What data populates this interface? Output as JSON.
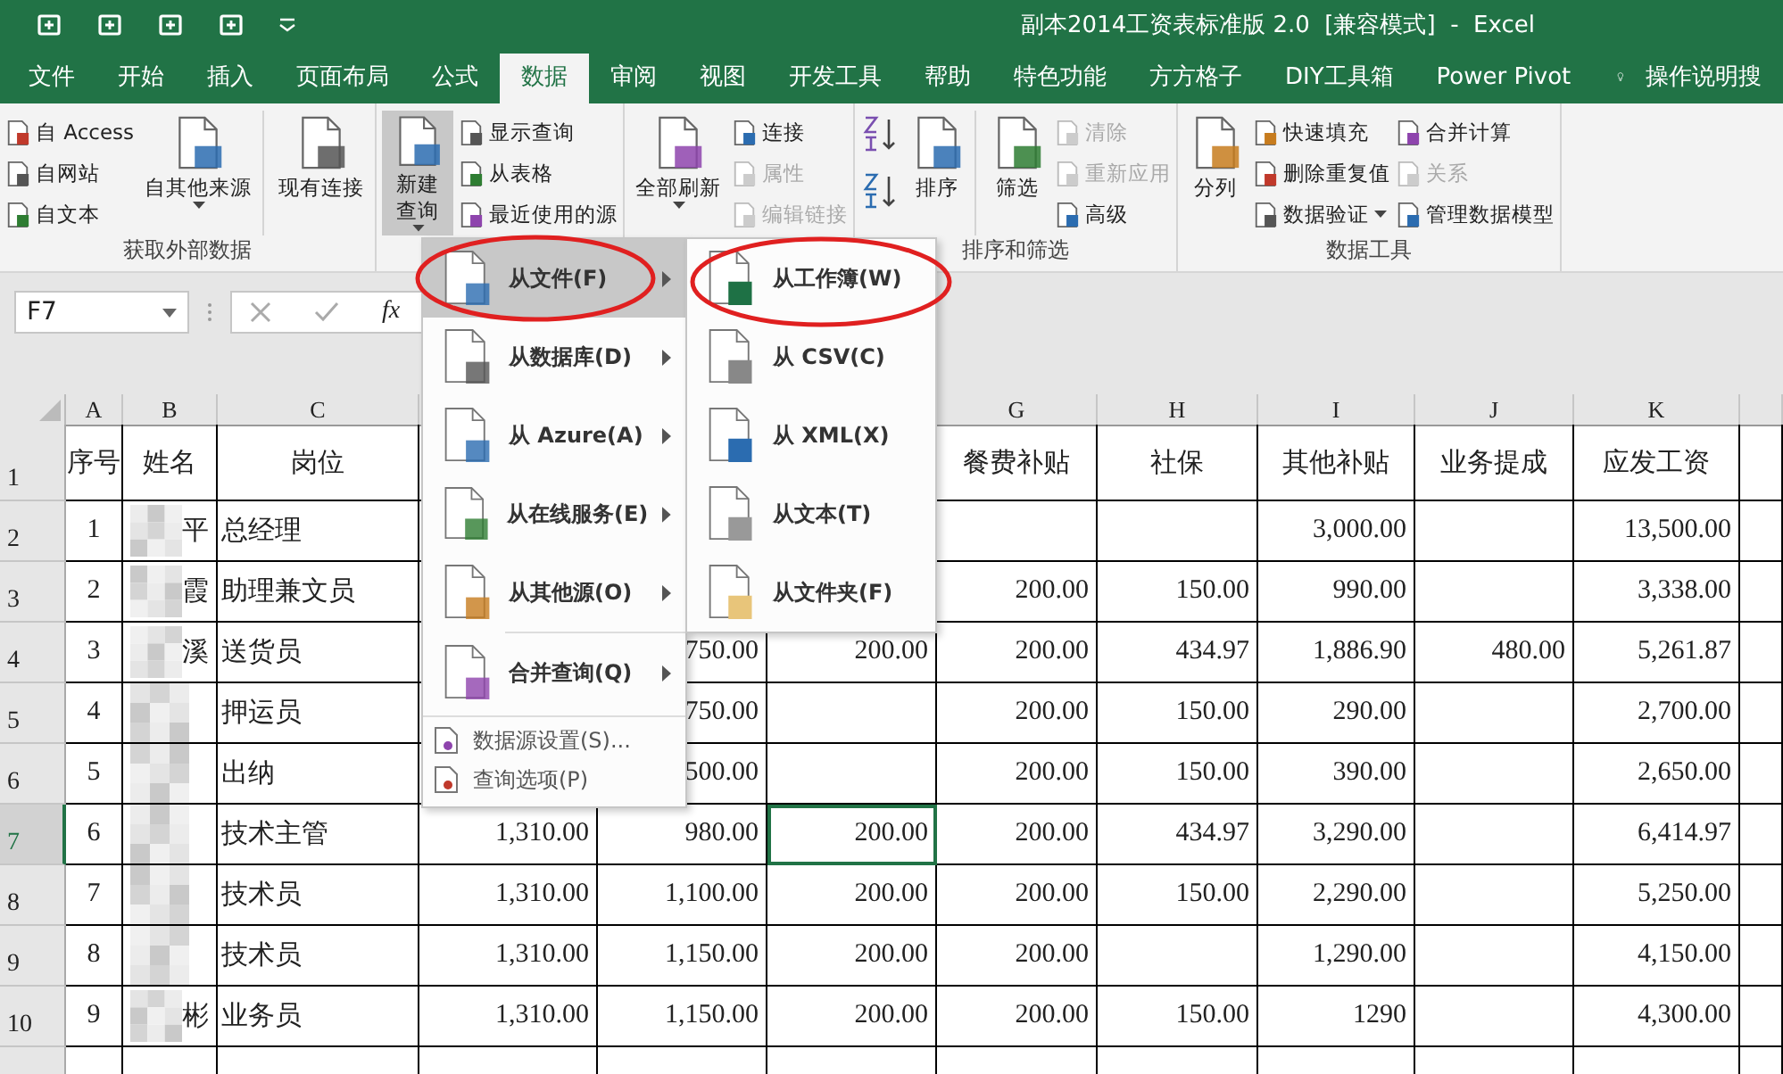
{
  "window": {
    "title": "副本2014工资表标准版 2.0  [兼容模式]  -  Excel"
  },
  "tabs": [
    {
      "label": "文件",
      "selected": false
    },
    {
      "label": "开始",
      "selected": false
    },
    {
      "label": "插入",
      "selected": false
    },
    {
      "label": "页面布局",
      "selected": false
    },
    {
      "label": "公式",
      "selected": false
    },
    {
      "label": "数据",
      "selected": true
    },
    {
      "label": "审阅",
      "selected": false
    },
    {
      "label": "视图",
      "selected": false
    },
    {
      "label": "开发工具",
      "selected": false
    },
    {
      "label": "帮助",
      "selected": false
    },
    {
      "label": "特色功能",
      "selected": false
    },
    {
      "label": "方方格子",
      "selected": false
    },
    {
      "label": "DIY工具箱",
      "selected": false
    },
    {
      "label": "Power Pivot",
      "selected": false
    }
  ],
  "tell_me": "操作说明搜",
  "ribbon": {
    "groups": [
      {
        "label": "获取外部数据",
        "columns": [
          {
            "kind": "stack",
            "items": [
              {
                "label": "自 Access",
                "disabled": false
              },
              {
                "label": "自网站",
                "disabled": false
              },
              {
                "label": "自文本",
                "disabled": false
              }
            ]
          },
          {
            "kind": "large",
            "label": "自其他来源",
            "dropdown": true,
            "pressed": false
          },
          {
            "kind": "large",
            "label": "现有连接",
            "dropdown": false,
            "pressed": false,
            "separator_before": true
          }
        ]
      },
      {
        "columns": [
          {
            "kind": "large",
            "label": "新建查询",
            "dropdown": true,
            "pressed": true
          },
          {
            "kind": "stack",
            "items": [
              {
                "label": "显示查询",
                "disabled": false
              },
              {
                "label": "从表格",
                "disabled": false
              },
              {
                "label": "最近使用的源",
                "disabled": false
              }
            ]
          }
        ]
      },
      {
        "columns": [
          {
            "kind": "large",
            "label": "全部刷新",
            "dropdown": true,
            "pressed": false
          },
          {
            "kind": "stack",
            "items": [
              {
                "label": "连接",
                "disabled": false
              },
              {
                "label": "属性",
                "disabled": true
              },
              {
                "label": "编辑链接",
                "disabled": true
              }
            ]
          }
        ]
      },
      {
        "label": "排序和筛选",
        "columns": [
          {
            "kind": "sort"
          },
          {
            "kind": "large",
            "label": "排序",
            "dropdown": false,
            "pressed": false
          },
          {
            "kind": "large",
            "label": "筛选",
            "dropdown": false,
            "pressed": false,
            "separator_before": true
          },
          {
            "kind": "stack",
            "items": [
              {
                "label": "清除",
                "disabled": true
              },
              {
                "label": "重新应用",
                "disabled": true
              },
              {
                "label": "高级",
                "disabled": false
              }
            ]
          }
        ]
      },
      {
        "label": "数据工具",
        "columns": [
          {
            "kind": "large",
            "label": "分列",
            "dropdown": false,
            "pressed": false
          },
          {
            "kind": "stack",
            "items": [
              {
                "label": "快速填充",
                "disabled": false
              },
              {
                "label": "删除重复值",
                "disabled": false
              },
              {
                "label": "数据验证",
                "disabled": false,
                "dropdown": true
              }
            ]
          },
          {
            "kind": "stack",
            "items": [
              {
                "label": "合并计算",
                "disabled": false
              },
              {
                "label": "关系",
                "disabled": true
              },
              {
                "label": "管理数据模型",
                "disabled": false
              }
            ]
          }
        ]
      }
    ]
  },
  "formula_bar": {
    "name_box": "F7",
    "fx": "fx"
  },
  "menu": {
    "items": [
      {
        "kind": "large",
        "label": "从文件(F)",
        "submenu": true,
        "selected": true
      },
      {
        "kind": "large",
        "label": "从数据库(D)",
        "submenu": true,
        "selected": false
      },
      {
        "kind": "large",
        "label": "从 Azure(A)",
        "submenu": true,
        "selected": false
      },
      {
        "kind": "large",
        "label": "从在线服务(E)",
        "submenu": true,
        "selected": false
      },
      {
        "kind": "large",
        "label": "从其他源(O)",
        "submenu": true,
        "selected": false
      },
      {
        "kind": "large",
        "label": "合并查询(Q)",
        "submenu": true,
        "selected": false,
        "separator_before": true
      },
      {
        "kind": "small",
        "label": "数据源设置(S)...",
        "selected": false,
        "separator_before": true
      },
      {
        "kind": "small",
        "label": "查询选项(P)",
        "selected": false
      }
    ],
    "submenu": {
      "items": [
        {
          "label": "从工作簿(W)"
        },
        {
          "label": "从 CSV(C)"
        },
        {
          "label": "从 XML(X)"
        },
        {
          "label": "从文本(T)"
        },
        {
          "label": "从文件夹(F)"
        }
      ]
    }
  },
  "sheet": {
    "columns": [
      {
        "letter": "A",
        "active": false
      },
      {
        "letter": "B",
        "active": false
      },
      {
        "letter": "C",
        "active": false
      },
      {
        "active": false
      },
      {
        "active": false
      },
      {
        "active": true
      },
      {
        "letter": "G",
        "active": false
      },
      {
        "letter": "H",
        "active": false
      },
      {
        "letter": "I",
        "active": false
      },
      {
        "letter": "J",
        "active": false
      },
      {
        "letter": "K",
        "active": false
      }
    ],
    "rows": [
      {
        "kind": "header",
        "num": "1",
        "selected": false,
        "cells": [
          "序号",
          "姓名",
          "岗位",
          null,
          null,
          null,
          "餐费补贴",
          "社保",
          "其他补贴",
          "业务提成",
          "应发工资"
        ]
      },
      {
        "kind": "data",
        "num": "2",
        "selected": false,
        "cells": [
          "1",
          "平",
          "总经理",
          null,
          null,
          null,
          null,
          null,
          "3,000.00",
          null,
          "13,500.00"
        ]
      },
      {
        "kind": "data",
        "num": "3",
        "selected": false,
        "cells": [
          "2",
          "霞",
          "助理兼文员",
          null,
          null,
          null,
          "200.00",
          "150.00",
          "990.00",
          null,
          "3,338.00"
        ]
      },
      {
        "kind": "data",
        "num": "4",
        "selected": false,
        "cells": [
          "3",
          "溪",
          "送货员",
          null,
          "750.00",
          "200.00",
          "200.00",
          "434.97",
          "1,886.90",
          "480.00",
          "5,261.87"
        ]
      },
      {
        "kind": "data",
        "num": "5",
        "selected": false,
        "cells": [
          "4",
          null,
          "押运员",
          null,
          "750.00",
          null,
          "200.00",
          "150.00",
          "290.00",
          null,
          "2,700.00"
        ]
      },
      {
        "kind": "data",
        "num": "6",
        "selected": false,
        "cells": [
          "5",
          null,
          "出纳",
          null,
          "500.00",
          null,
          "200.00",
          "150.00",
          "390.00",
          null,
          "2,650.00"
        ]
      },
      {
        "kind": "data",
        "num": "7",
        "selected": true,
        "cells": [
          "6",
          null,
          "技术主管",
          "1,310.00",
          "980.00",
          "200.00",
          "200.00",
          "434.97",
          "3,290.00",
          null,
          "6,414.97"
        ]
      },
      {
        "kind": "data",
        "num": "8",
        "selected": false,
        "cells": [
          "7",
          null,
          "技术员",
          "1,310.00",
          "1,100.00",
          "200.00",
          "200.00",
          "150.00",
          "2,290.00",
          null,
          "5,250.00"
        ]
      },
      {
        "kind": "data",
        "num": "9",
        "selected": false,
        "cells": [
          "8",
          null,
          "技术员",
          "1,310.00",
          "1,150.00",
          "200.00",
          "200.00",
          null,
          "1,290.00",
          null,
          "4,150.00"
        ]
      },
      {
        "kind": "data",
        "num": "10",
        "selected": false,
        "cells": [
          "9",
          "彬",
          "业务员",
          "1,310.00",
          "1,150.00",
          "200.00",
          "200.00",
          "150.00",
          "1290",
          null,
          "4,300.00"
        ]
      }
    ]
  }
}
